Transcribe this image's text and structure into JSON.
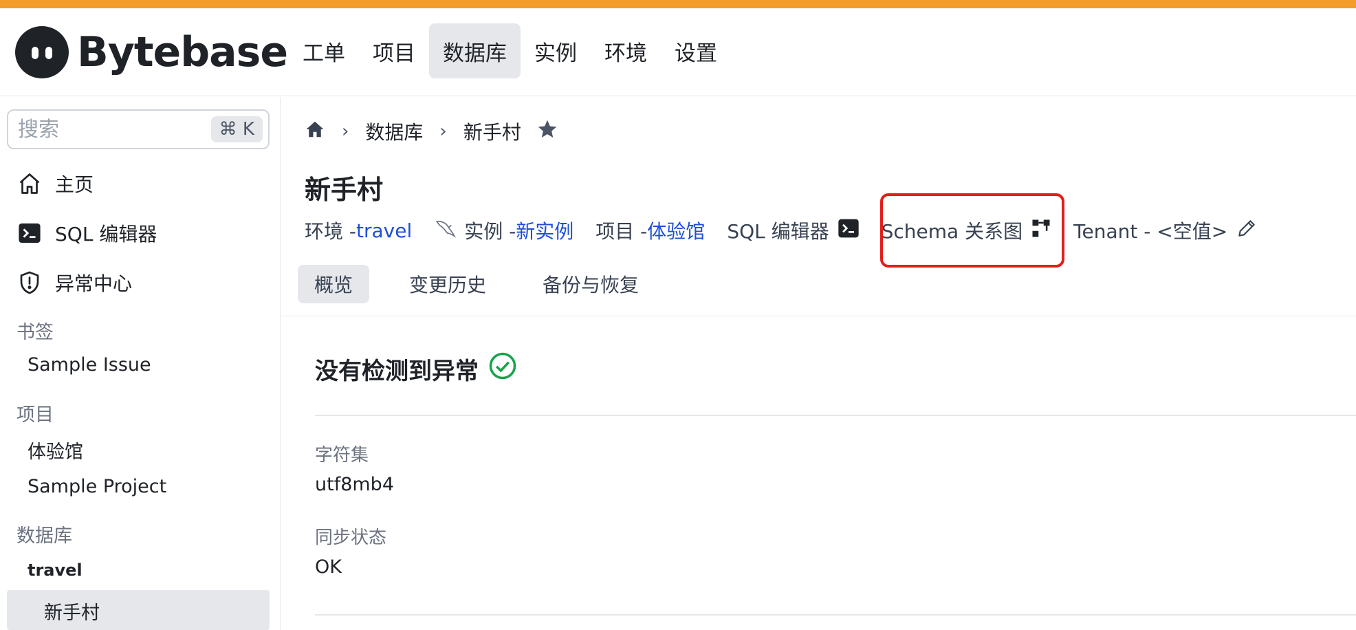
{
  "brand": {
    "name": "Bytebase",
    "accent_color": "#f39c2a"
  },
  "topnav": {
    "items": [
      {
        "label": "工单"
      },
      {
        "label": "项目"
      },
      {
        "label": "数据库",
        "active": true
      },
      {
        "label": "实例"
      },
      {
        "label": "环境"
      },
      {
        "label": "设置"
      }
    ]
  },
  "sidebar": {
    "search": {
      "placeholder": "搜索",
      "shortcut": "⌘ K"
    },
    "nav": [
      {
        "label": "主页",
        "icon": "home-icon"
      },
      {
        "label": "SQL 编辑器",
        "icon": "terminal-icon"
      },
      {
        "label": "异常中心",
        "icon": "shield-icon"
      }
    ],
    "bookmarks": {
      "title": "书签",
      "items": [
        "Sample Issue"
      ]
    },
    "projects": {
      "title": "项目",
      "items": [
        "体验馆",
        "Sample Project"
      ]
    },
    "databases": {
      "title": "数据库",
      "env": "travel",
      "items": [
        "新手村"
      ]
    }
  },
  "breadcrumb": {
    "items": [
      "数据库",
      "新手村"
    ]
  },
  "page": {
    "title": "新手村",
    "meta": {
      "env_label": "环境 - ",
      "env_value": "travel",
      "instance_label": "实例 - ",
      "instance_value": "新实例",
      "project_label": "项目 - ",
      "project_value": "体验馆",
      "sql_editor": "SQL 编辑器",
      "schema_diagram": "Schema 关系图",
      "tenant": "Tenant - <空值>"
    },
    "tabs": [
      {
        "label": "概览",
        "active": true
      },
      {
        "label": "变更历史"
      },
      {
        "label": "备份与恢复"
      }
    ],
    "status": "没有检测到异常",
    "fields": [
      {
        "label": "字符集",
        "value": "utf8mb4"
      },
      {
        "label": "同步状态",
        "value": "OK"
      }
    ]
  },
  "colors": {
    "link": "#1d4ed8",
    "success": "#16a34a",
    "highlight_box": "#e0201b"
  }
}
